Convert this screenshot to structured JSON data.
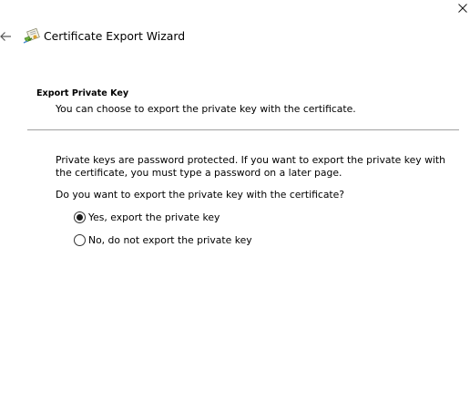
{
  "window": {
    "title": "Certificate Export Wizard",
    "icons": {
      "close": "close-icon",
      "back": "back-arrow-icon",
      "wizard": "certificate-wizard-icon"
    }
  },
  "section": {
    "heading": "Export Private Key",
    "subheading": "You can choose to export the private key with the certificate."
  },
  "body": {
    "info": "Private keys are password protected. If you want to export the private key with the certificate, you must type a password on a later page.",
    "question": "Do you want to export the private key with the certificate?"
  },
  "options": {
    "yes": {
      "label": "Yes, export the private key",
      "selected": true
    },
    "no": {
      "label": "No, do not export the private key",
      "selected": false
    }
  }
}
